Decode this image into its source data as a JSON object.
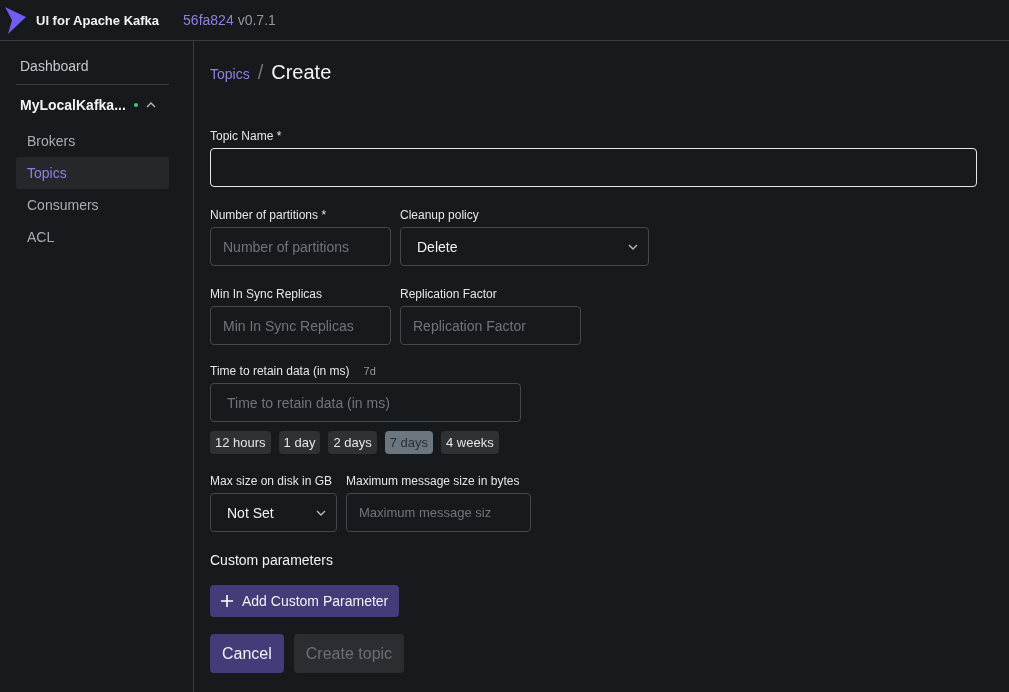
{
  "header": {
    "app_name": "UI for Apache Kafka",
    "commit": "56fa824",
    "version": "v0.7.1"
  },
  "sidebar": {
    "dashboard": {
      "label": "Dashboard",
      "selected": false
    },
    "cluster": {
      "name": "MyLocalKafka...",
      "online": true,
      "expanded": true,
      "items": [
        {
          "label": "Brokers",
          "selected": false
        },
        {
          "label": "Topics",
          "selected": true
        },
        {
          "label": "Consumers",
          "selected": false
        },
        {
          "label": "ACL",
          "selected": false
        }
      ]
    }
  },
  "breadcrumb": {
    "parent": "Topics",
    "separator": "/",
    "current": "Create"
  },
  "form": {
    "topic_name": {
      "label": "Topic Name *"
    },
    "partitions": {
      "label": "Number of partitions *",
      "placeholder": "Number of partitions"
    },
    "cleanup_policy": {
      "label": "Cleanup policy",
      "value": "Delete"
    },
    "min_insync": {
      "label": "Min In Sync Replicas",
      "placeholder": "Min In Sync Replicas"
    },
    "replication": {
      "label": "Replication Factor",
      "placeholder": "Replication Factor"
    },
    "retention": {
      "label": "Time to retain data (in ms)",
      "hint": "7d",
      "placeholder": "Time to retain data (in ms)",
      "presets": [
        {
          "label": "12 hours",
          "selected": false
        },
        {
          "label": "1 day",
          "selected": false
        },
        {
          "label": "2 days",
          "selected": false
        },
        {
          "label": "7 days",
          "selected": true
        },
        {
          "label": "4 weeks",
          "selected": false
        }
      ]
    },
    "max_disk": {
      "label": "Max size on disk in GB",
      "value": "Not Set"
    },
    "max_message": {
      "label": "Maximum message size in bytes",
      "placeholder": "Maximum message siz"
    },
    "custom_title": "Custom parameters",
    "add_button": "Add Custom Parameter",
    "cancel": {
      "label": "Cancel",
      "disabled": false
    },
    "submit": {
      "label": "Create topic",
      "disabled": true
    }
  }
}
